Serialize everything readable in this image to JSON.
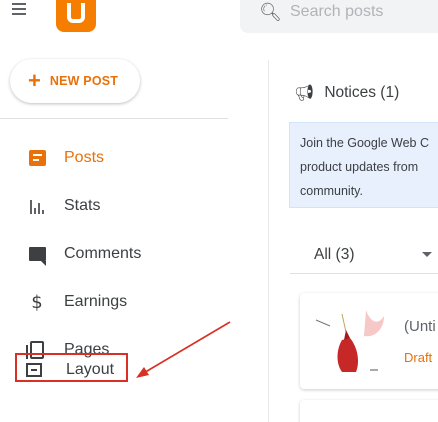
{
  "header": {
    "menu_icon": "hamburger-icon",
    "logo": "blogger-logo",
    "search": {
      "icon": "search-icon",
      "placeholder": "Search posts"
    }
  },
  "new_post": {
    "icon": "plus-icon",
    "label": "NEW POST"
  },
  "sidebar": {
    "items": [
      {
        "icon": "posts-icon",
        "label": "Posts",
        "active": true
      },
      {
        "icon": "stats-icon",
        "label": "Stats"
      },
      {
        "icon": "comments-icon",
        "label": "Comments"
      },
      {
        "icon": "dollar-icon",
        "label": "Earnings"
      },
      {
        "icon": "pages-icon",
        "label": "Pages"
      },
      {
        "icon": "layout-icon",
        "label": "Layout",
        "highlighted": true
      }
    ]
  },
  "notices": {
    "icon": "megaphone-icon",
    "label": "Notices (1)",
    "card_lines": [
      "Join the Google Web C",
      "product updates from",
      "community."
    ]
  },
  "filter": {
    "label": "All (3)",
    "icon": "caret-down-icon"
  },
  "post": {
    "title": "(Unti",
    "status": "Draft"
  },
  "colors": {
    "accent": "#e8710a",
    "highlight_box": "#d93025",
    "notice_bg": "#e8f0fe"
  }
}
